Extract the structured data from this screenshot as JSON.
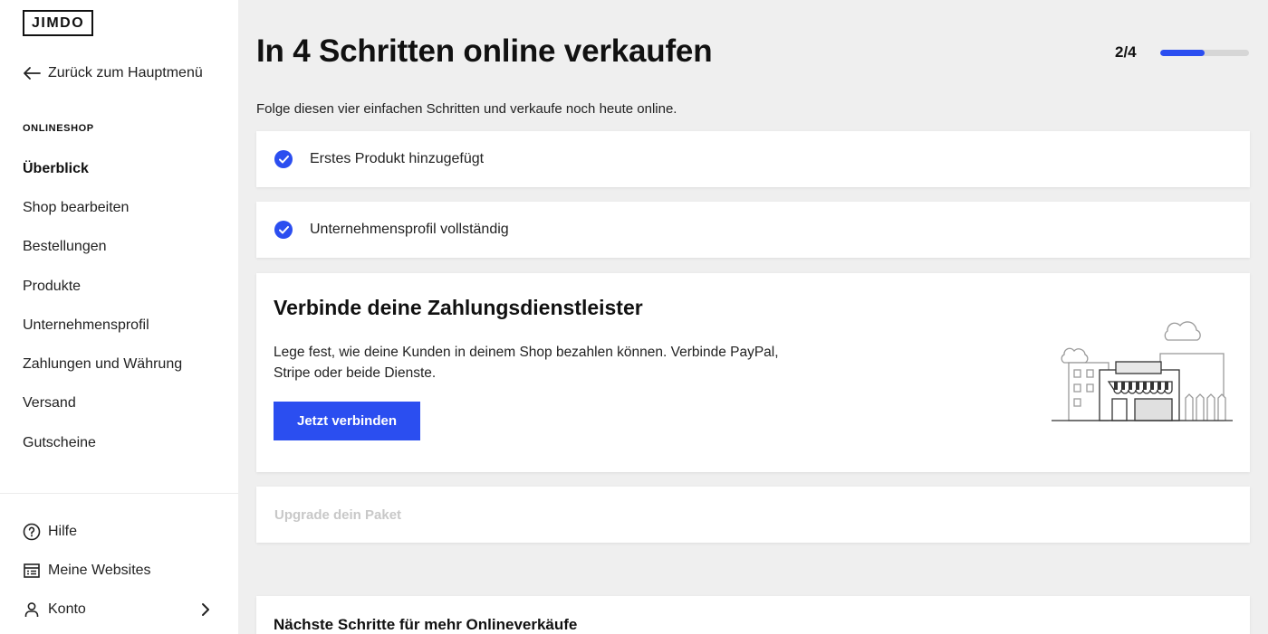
{
  "app": {
    "logo": "JIMDO"
  },
  "sidebar": {
    "back_label": "Zurück zum Hauptmenü",
    "section_label": "ONLINESHOP",
    "items": [
      {
        "label": "Überblick",
        "active": true
      },
      {
        "label": "Shop bearbeiten"
      },
      {
        "label": "Bestellungen"
      },
      {
        "label": "Produkte"
      },
      {
        "label": "Unternehmensprofil"
      },
      {
        "label": "Zahlungen und Währung"
      },
      {
        "label": "Versand"
      },
      {
        "label": "Gutscheine"
      }
    ],
    "bottom": {
      "help": "Hilfe",
      "websites": "Meine Websites",
      "account": "Konto"
    }
  },
  "main": {
    "title": "In 4 Schritten online verkaufen",
    "progress": {
      "label": "2/4",
      "fraction": 0.5
    },
    "intro": "Folge diesen vier einfachen Schritten und verkaufe noch heute online.",
    "steps_done": [
      "Erstes Produkt hinzugefügt",
      "Unternehmensprofil vollständig"
    ],
    "active_step": {
      "title": "Verbinde deine Zahlungsdienstleister",
      "description": "Lege fest, wie deine Kunden in deinem Shop bezahlen können. Verbinde PayPal, Stripe oder beide Dienste.",
      "button": "Jetzt verbinden"
    },
    "disabled_step": "Upgrade dein Paket",
    "next_section_title": "Nächste Schritte für mehr Onlineverkäufe"
  },
  "colors": {
    "accent": "#2b4ef0",
    "background": "#efefef"
  }
}
